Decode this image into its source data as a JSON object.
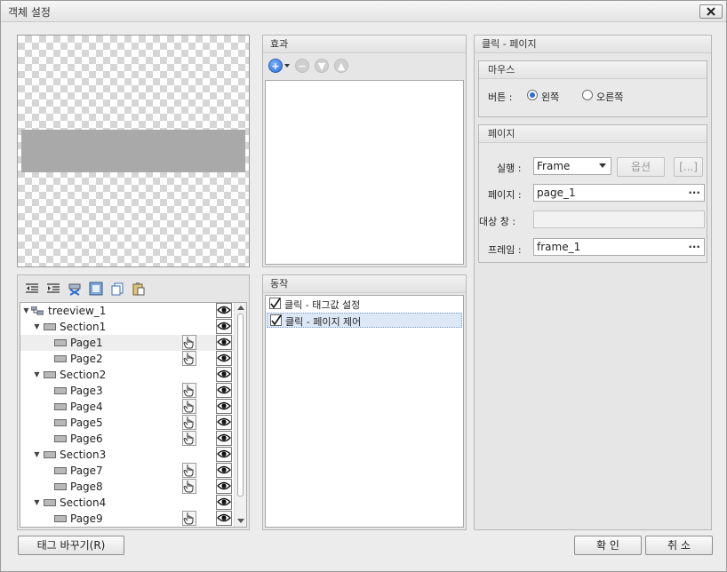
{
  "window": {
    "title": "객체 설정"
  },
  "tree": {
    "items": [
      {
        "label": "treeview_1",
        "level": 0,
        "expander": "▼",
        "type": "root",
        "hand": false
      },
      {
        "label": "Section1",
        "level": 1,
        "expander": "▼",
        "type": "section",
        "hand": false
      },
      {
        "label": "Page1",
        "level": 2,
        "expander": "",
        "type": "page",
        "hand": true,
        "selected": true
      },
      {
        "label": "Page2",
        "level": 2,
        "expander": "",
        "type": "page",
        "hand": true
      },
      {
        "label": "Section2",
        "level": 1,
        "expander": "▼",
        "type": "section",
        "hand": false
      },
      {
        "label": "Page3",
        "level": 2,
        "expander": "",
        "type": "page",
        "hand": true
      },
      {
        "label": "Page4",
        "level": 2,
        "expander": "",
        "type": "page",
        "hand": true
      },
      {
        "label": "Page5",
        "level": 2,
        "expander": "",
        "type": "page",
        "hand": true
      },
      {
        "label": "Page6",
        "level": 2,
        "expander": "",
        "type": "page",
        "hand": true
      },
      {
        "label": "Section3",
        "level": 1,
        "expander": "▼",
        "type": "section",
        "hand": false
      },
      {
        "label": "Page7",
        "level": 2,
        "expander": "",
        "type": "page",
        "hand": true
      },
      {
        "label": "Page8",
        "level": 2,
        "expander": "",
        "type": "page",
        "hand": true
      },
      {
        "label": "Section4",
        "level": 1,
        "expander": "▼",
        "type": "section",
        "hand": false
      },
      {
        "label": "Page9",
        "level": 2,
        "expander": "",
        "type": "page",
        "hand": true
      }
    ]
  },
  "effects": {
    "title": "효과"
  },
  "actions": {
    "title": "동작",
    "items": [
      {
        "label": "클릭 - 태그값 설정",
        "checked": true
      },
      {
        "label": "클릭 - 페이지 제어",
        "checked": true,
        "selected": true
      }
    ]
  },
  "right": {
    "title": "클릭 - 페이지",
    "mouse": {
      "title": "마우스",
      "button_label": "버튼 :",
      "left_label": "왼쪽",
      "right_label": "오른쪽",
      "selected": "left"
    },
    "page": {
      "title": "페이지",
      "run_label": "실행 :",
      "run_value": "Frame",
      "option_button": "옵션",
      "browse_button": "[...]",
      "page_label": "페이지 :",
      "page_value": "page_1",
      "target_label": "대상 창 :",
      "target_value": "",
      "frame_label": "프레임 :",
      "frame_value": "frame_1",
      "dots": "···"
    }
  },
  "footer": {
    "change_tag": "태그 바꾸기(R)",
    "ok": "확 인",
    "cancel": "취 소"
  }
}
